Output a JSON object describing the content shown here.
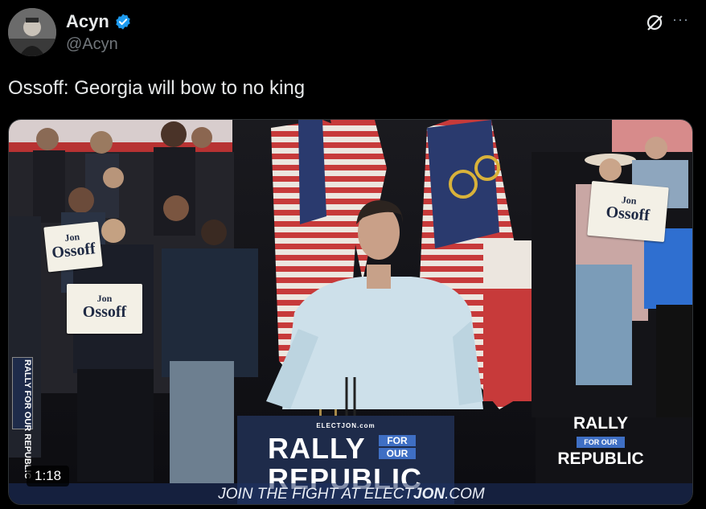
{
  "author": {
    "display_name": "Acyn",
    "handle": "@Acyn",
    "verified": true,
    "verified_color": "#1d9bf0"
  },
  "actions": {
    "grok_icon": "grok-icon",
    "more_icon": "more-horizontal-icon"
  },
  "tweet": {
    "text": "Ossoff: Georgia will bow to no king"
  },
  "video": {
    "duration": "1:18",
    "podium_sign": {
      "top": "ELECTJON.com",
      "rally": "RALLY",
      "for": "FOR",
      "our": "OUR",
      "republic": "REPUBLIC"
    },
    "right_banner": {
      "rally": "RALLY",
      "for_our": "FOR OUR",
      "republic": "REPUBLIC"
    },
    "footer_prefix": "JOIN THE FIGHT AT ELECT",
    "footer_bold": "JON",
    "footer_suffix": ".COM",
    "signs": [
      {
        "line1": "Jon",
        "line2": "Ossoff"
      },
      {
        "line1": "Jon",
        "line2": "Ossoff"
      },
      {
        "line1": "Jon",
        "line2": "Ossoff"
      }
    ],
    "side_banner": "RALLY FOR OUR REPUBLIC"
  },
  "colors": {
    "background": "#000000",
    "text_primary": "#e7e9ea",
    "text_secondary": "#71767b",
    "accent_blue": "#3f6fc4",
    "navy": "#1e2b4a"
  }
}
